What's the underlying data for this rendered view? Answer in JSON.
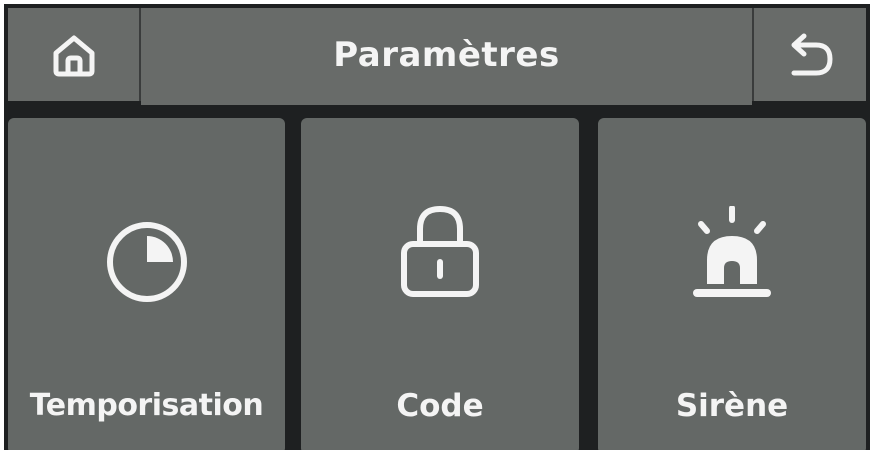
{
  "header": {
    "title": "Paramètres",
    "home_icon": "home-icon",
    "back_icon": "back-arrow-icon"
  },
  "tiles": [
    {
      "label": "Temporisation",
      "icon": "timer-icon"
    },
    {
      "label": "Code",
      "icon": "lock-icon"
    },
    {
      "label": "Sirène",
      "icon": "siren-icon"
    }
  ],
  "colors": {
    "background": "#1e2021",
    "panel": "#656866",
    "text": "#f4f4f4"
  }
}
